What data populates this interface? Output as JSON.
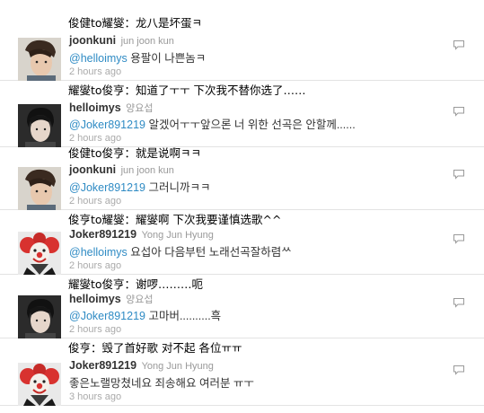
{
  "items": [
    {
      "caption": "俊健to耀燮：龙八是坏蛋ㅋ",
      "screen_name": "joonkuni",
      "full_name": "jun joon kun",
      "mention": "@helloimys",
      "text": " 용팔이 나쁜놈ㅋ",
      "time": "2 hours ago",
      "avatar": "boy"
    },
    {
      "caption": "耀燮to俊亨：知道了ㅜㅜ 下次我不替你选了……",
      "screen_name": "helloimys",
      "full_name": "양요섭",
      "mention": "@Joker891219",
      "text": " 알겠어ㅜㅜ앞으론 너 위한 선곡은 안할께......",
      "time": "2 hours ago",
      "avatar": "ys"
    },
    {
      "caption": "俊健to俊亨：就是说啊ㅋㅋ",
      "screen_name": "joonkuni",
      "full_name": "jun joon kun",
      "mention": "@Joker891219",
      "text": " 그러니까ㅋㅋ",
      "time": "2 hours ago",
      "avatar": "boy"
    },
    {
      "caption": "俊亨to耀燮：耀燮啊 下次我要谨慎选歌^^",
      "screen_name": "Joker891219",
      "full_name": "Yong Jun Hyung",
      "mention": "@helloimys",
      "text": " 요섭아 다음부턴 노래선곡잘하렴ᄊ",
      "time": "2 hours ago",
      "avatar": "clown"
    },
    {
      "caption": "耀燮to俊亨：谢啰………呃",
      "screen_name": "helloimys",
      "full_name": "양요섭",
      "mention": "@Joker891219",
      "text": " 고마버..........흑",
      "time": "2 hours ago",
      "avatar": "ys"
    },
    {
      "caption": "俊亨：毁了首好歌 对不起 各位ㅠㅠ",
      "screen_name": "Joker891219",
      "full_name": "Yong Jun Hyung",
      "mention": "",
      "text": "좋은노랠망쳤네요 죄송해요 여러분 ㅠㅜ",
      "time": "3 hours ago",
      "avatar": "clown"
    }
  ]
}
